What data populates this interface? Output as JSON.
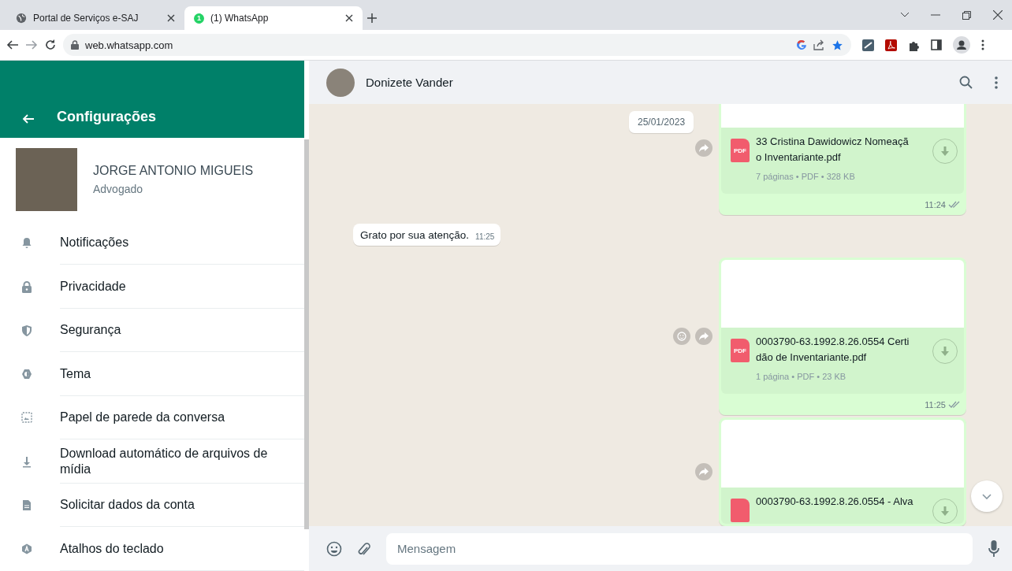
{
  "browser": {
    "tabs": [
      {
        "title": "Portal de Serviços e-SAJ",
        "selected": false
      },
      {
        "title": "(1) WhatsApp",
        "badge": "1",
        "selected": true
      }
    ],
    "url": "web.whatsapp.com"
  },
  "settings": {
    "title": "Configurações",
    "profile": {
      "name": "JORGE ANTONIO MIGUEIS",
      "about": "Advogado"
    },
    "items": [
      {
        "label": "Notificações"
      },
      {
        "label": "Privacidade"
      },
      {
        "label": "Segurança"
      },
      {
        "label": "Tema"
      },
      {
        "label": "Papel de parede da conversa"
      },
      {
        "label": "Download automático de arquivos de mídia"
      },
      {
        "label": "Solicitar dados da conta"
      },
      {
        "label": "Atalhos do teclado"
      }
    ]
  },
  "chat": {
    "contact": "Donizete Vander",
    "date_chip": "25/01/2023",
    "messages": [
      {
        "kind": "document",
        "outgoing": true,
        "preview_cut": true,
        "file_badge": "PDF",
        "name_lines": [
          "33 Cristina Dawidowicz Nomeaçã",
          "o Inventariante.pdf"
        ],
        "meta": "7 páginas • PDF • 328 KB",
        "time": "11:24",
        "read": false
      },
      {
        "kind": "text",
        "outgoing": false,
        "text": "Grato por sua atenção.",
        "time": "11:25"
      },
      {
        "kind": "document",
        "outgoing": true,
        "preview_cut": false,
        "file_badge": "PDF",
        "name_lines": [
          "0003790-63.1992.8.26.0554 Certi",
          "dão de Inventariante.pdf"
        ],
        "meta": "1 página • PDF • 23 KB",
        "time": "11:25",
        "read": false,
        "reaction_button": true
      },
      {
        "kind": "document",
        "outgoing": true,
        "preview_cut": false,
        "name_lines": [
          "0003790-63.1992.8.26.0554 - Alva"
        ]
      }
    ],
    "composer": {
      "placeholder": "Mensagem"
    }
  }
}
